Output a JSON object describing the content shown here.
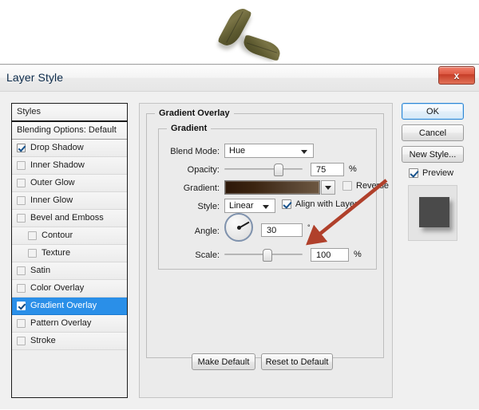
{
  "canvas": {
    "objects": [
      {
        "name": "leaf-1",
        "kind": "bay-leaf"
      },
      {
        "name": "leaf-2",
        "kind": "bay-leaf"
      }
    ]
  },
  "dialog": {
    "title": "Layer Style",
    "close_label": "x",
    "close_icon": "close-icon"
  },
  "styles_panel": {
    "header": "Styles",
    "subheader": "Blending Options: Default",
    "items": [
      {
        "label": "Drop Shadow",
        "checked": true,
        "indent": false,
        "selected": false,
        "enabled": true
      },
      {
        "label": "Inner Shadow",
        "checked": false,
        "indent": false,
        "selected": false,
        "enabled": false
      },
      {
        "label": "Outer Glow",
        "checked": false,
        "indent": false,
        "selected": false,
        "enabled": false
      },
      {
        "label": "Inner Glow",
        "checked": false,
        "indent": false,
        "selected": false,
        "enabled": false
      },
      {
        "label": "Bevel and Emboss",
        "checked": false,
        "indent": false,
        "selected": false,
        "enabled": false
      },
      {
        "label": "Contour",
        "checked": false,
        "indent": true,
        "selected": false,
        "enabled": false
      },
      {
        "label": "Texture",
        "checked": false,
        "indent": true,
        "selected": false,
        "enabled": false
      },
      {
        "label": "Satin",
        "checked": false,
        "indent": false,
        "selected": false,
        "enabled": false
      },
      {
        "label": "Color Overlay",
        "checked": false,
        "indent": false,
        "selected": false,
        "enabled": false
      },
      {
        "label": "Gradient Overlay",
        "checked": true,
        "indent": false,
        "selected": true,
        "enabled": true
      },
      {
        "label": "Pattern Overlay",
        "checked": false,
        "indent": false,
        "selected": false,
        "enabled": false
      },
      {
        "label": "Stroke",
        "checked": false,
        "indent": false,
        "selected": false,
        "enabled": false
      }
    ]
  },
  "main_panel": {
    "group_title": "Gradient Overlay",
    "subgroup_title": "Gradient",
    "blend_mode": {
      "label": "Blend Mode:",
      "value": "Hue"
    },
    "opacity": {
      "label": "Opacity:",
      "value": "75",
      "unit": "%",
      "percent": 70
    },
    "gradient": {
      "label": "Gradient:",
      "stops": [
        "#2c1709",
        "#3b2410",
        "#55412e",
        "#6d5741"
      ],
      "reverse_label": "Reverse",
      "reverse_checked": false
    },
    "style": {
      "label": "Style:",
      "value": "Linear",
      "align_label": "Align with Layer",
      "align_checked": true
    },
    "angle": {
      "label": "Angle:",
      "value": "30",
      "unit": "°",
      "degrees": 30
    },
    "scale": {
      "label": "Scale:",
      "value": "100",
      "unit": "%",
      "percent": 55
    },
    "make_default_label": "Make Default",
    "reset_default_label": "Reset to Default"
  },
  "right_panel": {
    "ok_label": "OK",
    "cancel_label": "Cancel",
    "new_style_label": "New Style...",
    "preview_label": "Preview",
    "preview_checked": true
  },
  "annotation": {
    "arrow_color": "#b0402b",
    "points_to": "opacity-value-field"
  },
  "colors": {
    "selection_blue": "#2a8fe8",
    "dialog_bg": "#f0f0f0",
    "panel_bg": "#ebebeb",
    "close_red": "#c63d27"
  }
}
